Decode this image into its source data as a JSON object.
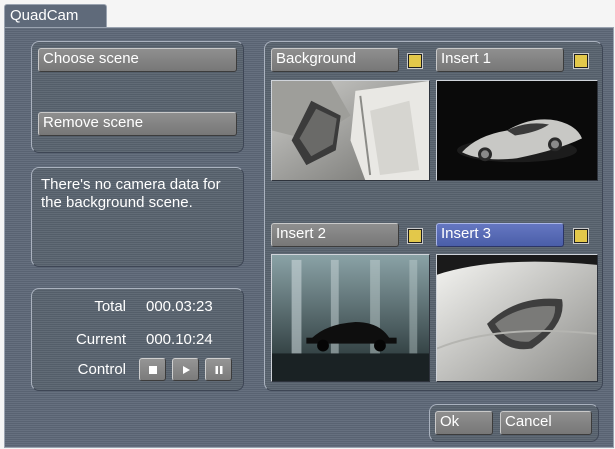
{
  "window": {
    "title": "QuadCam"
  },
  "left": {
    "choose_scene_label": "Choose scene",
    "remove_scene_label": "Remove scene",
    "info_text": "There's no camera data for the background scene."
  },
  "stats": {
    "total_label": "Total",
    "total_value": "000.03:23",
    "current_label": "Current",
    "current_value": "000.10:24",
    "control_label": "Control",
    "control_icons": [
      "stop-icon",
      "play-icon",
      "pause-icon"
    ]
  },
  "quad": {
    "slots": [
      {
        "label": "Background",
        "selected": false,
        "thumb": "car-interior-seat"
      },
      {
        "label": "Insert 1",
        "selected": false,
        "thumb": "silver-sports-car"
      },
      {
        "label": "Insert 2",
        "selected": false,
        "thumb": "car-in-garage"
      },
      {
        "label": "Insert 3",
        "selected": true,
        "thumb": "car-headlight-closeup"
      }
    ]
  },
  "footer": {
    "ok_label": "Ok",
    "cancel_label": "Cancel"
  },
  "colors": {
    "window_bg": "#5e6878",
    "button": "#818181",
    "button_selected": "#5468b6",
    "toggle": "#e3c84a"
  }
}
